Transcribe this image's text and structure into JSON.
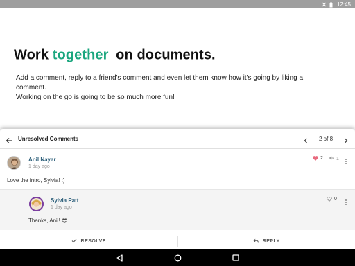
{
  "status_bar": {
    "time": "12:45",
    "icons": [
      "no-sim-icon",
      "battery-icon"
    ]
  },
  "hero": {
    "headline_before": "Work ",
    "headline_accent": "together",
    "headline_after": " on documents.",
    "accent_color": "#1aa67e",
    "description_line1": "Add a comment, reply to a friend's comment and even let them know how it's going by liking a comment.",
    "description_line2": "Working on the go is going to be so much more fun!"
  },
  "comments_panel": {
    "title": "Unresolved Comments",
    "pager": "2 of 8",
    "comment": {
      "author": "Anil Nayar",
      "time": "1 day ago",
      "body": "Love the intro, Sylvia! :)",
      "likes": "2",
      "replies": "1",
      "liked": true
    },
    "reply": {
      "author": "Sylvia Patt",
      "time": "1 day ago",
      "body": "Thanks, Anil! 😎",
      "likes": "0"
    },
    "actions": {
      "resolve_label": "RESOLVE",
      "reply_label": "REPLY"
    },
    "like_color": "#e86b7f"
  },
  "nav_bar": {
    "icons": [
      "back-triangle-icon",
      "home-circle-icon",
      "recents-square-icon"
    ]
  }
}
